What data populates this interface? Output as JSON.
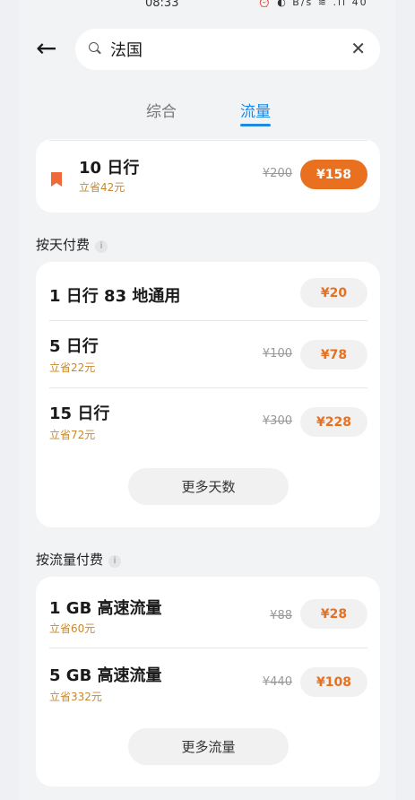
{
  "status_bar": {
    "time": "08:33",
    "icons_text": "⏰ ◐ B/s ≋ .ıl 40"
  },
  "search": {
    "value": "法国"
  },
  "tabs": [
    {
      "label": "综合"
    },
    {
      "label": "流量"
    }
  ],
  "top_card": {
    "title": "10 日行",
    "save": "立省42元",
    "old_price": "¥200",
    "price": "¥158"
  },
  "daily": {
    "section_title": "按天付费",
    "info_glyph": "i",
    "rows": [
      {
        "title": "1 日行  83 地通用",
        "save": "",
        "old_price": "",
        "price": "¥20"
      },
      {
        "title": "5 日行",
        "save": "立省22元",
        "old_price": "¥100",
        "price": "¥78"
      },
      {
        "title": "15 日行",
        "save": "立省72元",
        "old_price": "¥300",
        "price": "¥228"
      }
    ],
    "more_label": "更多天数"
  },
  "traffic": {
    "section_title": "按流量付费",
    "info_glyph": "i",
    "rows": [
      {
        "title": "1 GB 高速流量",
        "save": "立省60元",
        "old_price": "¥88",
        "price": "¥28"
      },
      {
        "title": "5 GB 高速流量",
        "save": "立省332元",
        "old_price": "¥440",
        "price": "¥108"
      }
    ],
    "more_label": "更多流量"
  },
  "colors": {
    "accent": "#e8701f",
    "tab_active": "#1e88e5",
    "save_text": "#c7892e"
  }
}
